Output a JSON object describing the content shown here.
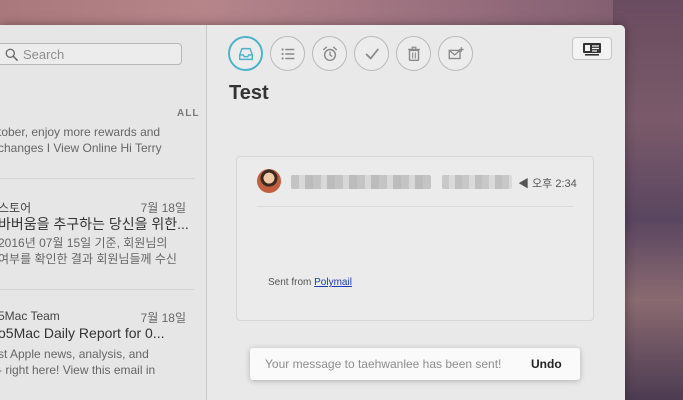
{
  "search": {
    "placeholder": "Search"
  },
  "list": {
    "filter_label": "ALL",
    "items": [
      {
        "sender": "",
        "date": "",
        "subject": "",
        "preview_lines": [
          "tober, enjoy more rewards and",
          "changes I View Online Hi Terry"
        ]
      },
      {
        "sender": "스토어",
        "date": "7월 18일",
        "subject": "바버움을 추구하는 당신을 위한...",
        "preview_lines": [
          "2016년 07월 15일 기준, 회원님의",
          "여부를 확인한 결과 회원님들께 수신"
        ]
      },
      {
        "sender": "5Mac Team",
        "date": "7월 18일",
        "subject": "o5Mac Daily Report for 0...",
        "preview_lines": [
          "st Apple news, analysis, and",
          "- right here! View this email in"
        ]
      }
    ]
  },
  "message": {
    "subject": "Test",
    "time": "◀ 오후 2:34",
    "sent_from_prefix": "Sent from ",
    "sent_from_link": "Polymail"
  },
  "toast": {
    "message": "Your message to taehwanlee has been sent!",
    "undo_label": "Undo"
  },
  "colors": {
    "accent": "#4eb3c9",
    "link": "#1a3fb5"
  }
}
